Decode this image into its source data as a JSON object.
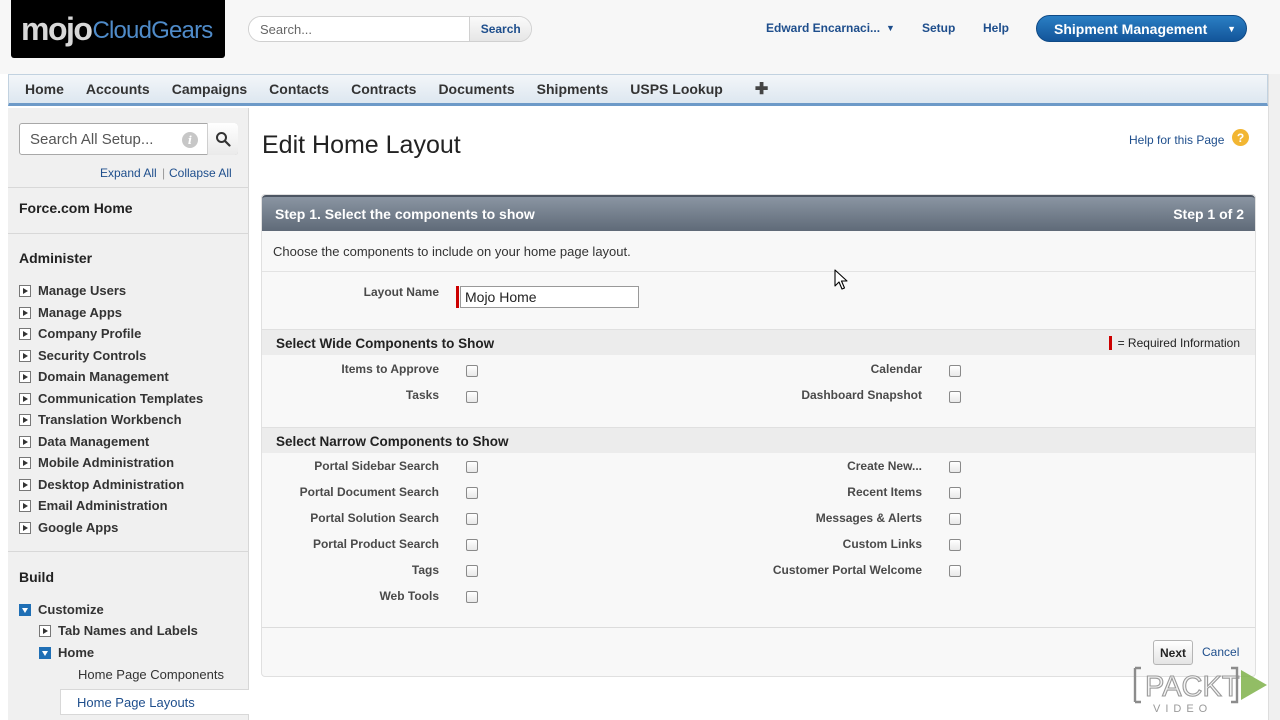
{
  "header": {
    "logo_mojo": "mojo",
    "logo_cloudgears": "CloudGears",
    "search_placeholder": "Search...",
    "search_button": "Search",
    "user_name": "Edward Encarnaci...",
    "setup": "Setup",
    "help": "Help",
    "app_menu": "Shipment Management"
  },
  "tabs": [
    "Home",
    "Accounts",
    "Campaigns",
    "Contacts",
    "Contracts",
    "Documents",
    "Shipments",
    "USPS Lookup"
  ],
  "sidebar": {
    "search_placeholder": "Search All Setup...",
    "expand_all": "Expand All",
    "separator": "|",
    "collapse_all": "Collapse All",
    "force_home": "Force.com Home",
    "administer_title": "Administer",
    "administer_items": [
      "Manage Users",
      "Manage Apps",
      "Company Profile",
      "Security Controls",
      "Domain Management",
      "Communication Templates",
      "Translation Workbench",
      "Data Management",
      "Mobile Administration",
      "Desktop Administration",
      "Email Administration",
      "Google Apps"
    ],
    "build_title": "Build",
    "customize": "Customize",
    "tab_names_labels": "Tab Names and Labels",
    "home": "Home",
    "home_page_components": "Home Page Components",
    "home_page_layouts": "Home Page Layouts"
  },
  "main": {
    "title": "Edit Home Layout",
    "help_link": "Help for this Page",
    "step_title": "Step 1. Select the components to show",
    "step_count": "Step 1 of 2",
    "intro": "Choose the components to include on your home page layout.",
    "layout_name_label": "Layout Name",
    "layout_name_value": "Mojo Home",
    "wide_section": "Select Wide Components to Show",
    "required_info": "= Required Information",
    "wide_left": [
      "Items to Approve",
      "Tasks"
    ],
    "wide_right": [
      "Calendar",
      "Dashboard Snapshot"
    ],
    "narrow_section": "Select Narrow Components to Show",
    "narrow_left": [
      "Portal Sidebar Search",
      "Portal Document Search",
      "Portal Solution Search",
      "Portal Product Search",
      "Tags",
      "Web Tools"
    ],
    "narrow_right": [
      "Create New...",
      "Recent Items",
      "Messages & Alerts",
      "Custom Links",
      "Customer Portal Welcome"
    ],
    "next_button": "Next",
    "cancel_link": "Cancel"
  },
  "watermark": {
    "brand": "PACKT",
    "sub": "VIDEO"
  },
  "colors": {
    "link_blue": "#1e4e8c",
    "app_menu_blue": "#1b6ab1",
    "step_bar_gray": "#6d7886",
    "required_red": "#c00000",
    "help_icon_orange": "#f2b632"
  }
}
